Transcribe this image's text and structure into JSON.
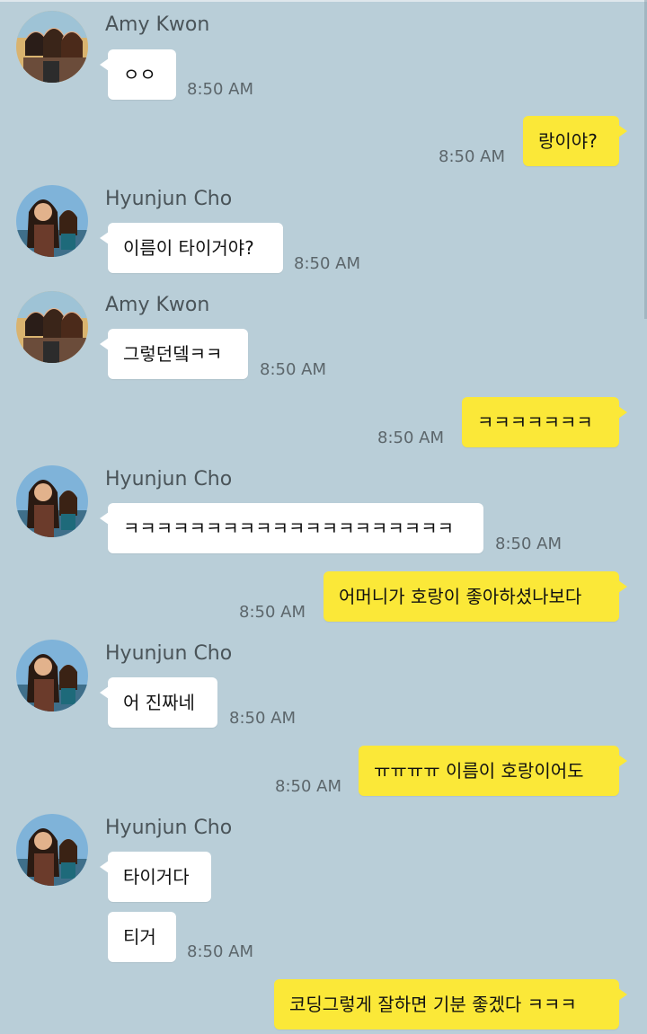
{
  "messages": [
    {
      "sender": "Amy Kwon",
      "text": "ㅇㅇ",
      "time": "8:50 AM"
    },
    {
      "sender": "me",
      "text": "랑이야?",
      "time": "8:50 AM"
    },
    {
      "sender": "Hyunjun Cho",
      "text": "이름이 타이거야?",
      "time": "8:50 AM"
    },
    {
      "sender": "Amy Kwon",
      "text": "그렇던뎈ㅋㅋ",
      "time": "8:50 AM"
    },
    {
      "sender": "me",
      "text": "ㅋㅋㅋㅋㅋㅋㅋ",
      "time": "8:50 AM"
    },
    {
      "sender": "Hyunjun Cho",
      "text": "ㅋㅋㅋㅋㅋㅋㅋㅋㅋㅋㅋㅋㅋㅋㅋㅋㅋㅋㅋㅋ",
      "time": "8:50 AM"
    },
    {
      "sender": "me",
      "text": "어머니가 호랑이 좋아하셨나보다",
      "time": "8:50 AM"
    },
    {
      "sender": "Hyunjun Cho",
      "text": "어 진짜네",
      "time": "8:50 AM"
    },
    {
      "sender": "me",
      "text": "ㅠㅠㅠㅠ 이름이 호랑이어도",
      "time": "8:50 AM"
    },
    {
      "sender": "Hyunjun Cho",
      "text": "타이거다",
      "time": ""
    },
    {
      "sender": "Hyunjun Cho",
      "text": "티거",
      "time": "8:50 AM"
    },
    {
      "sender": "me",
      "text": "코딩그렇게 잘하면 기분 좋겠다 ㅋㅋㅋ",
      "time": ""
    }
  ],
  "colors": {
    "background": "#b9ced8",
    "incoming_bubble": "#ffffff",
    "outgoing_bubble": "#fbe838",
    "name_text": "#4a5459",
    "time_text": "#5c666b"
  }
}
